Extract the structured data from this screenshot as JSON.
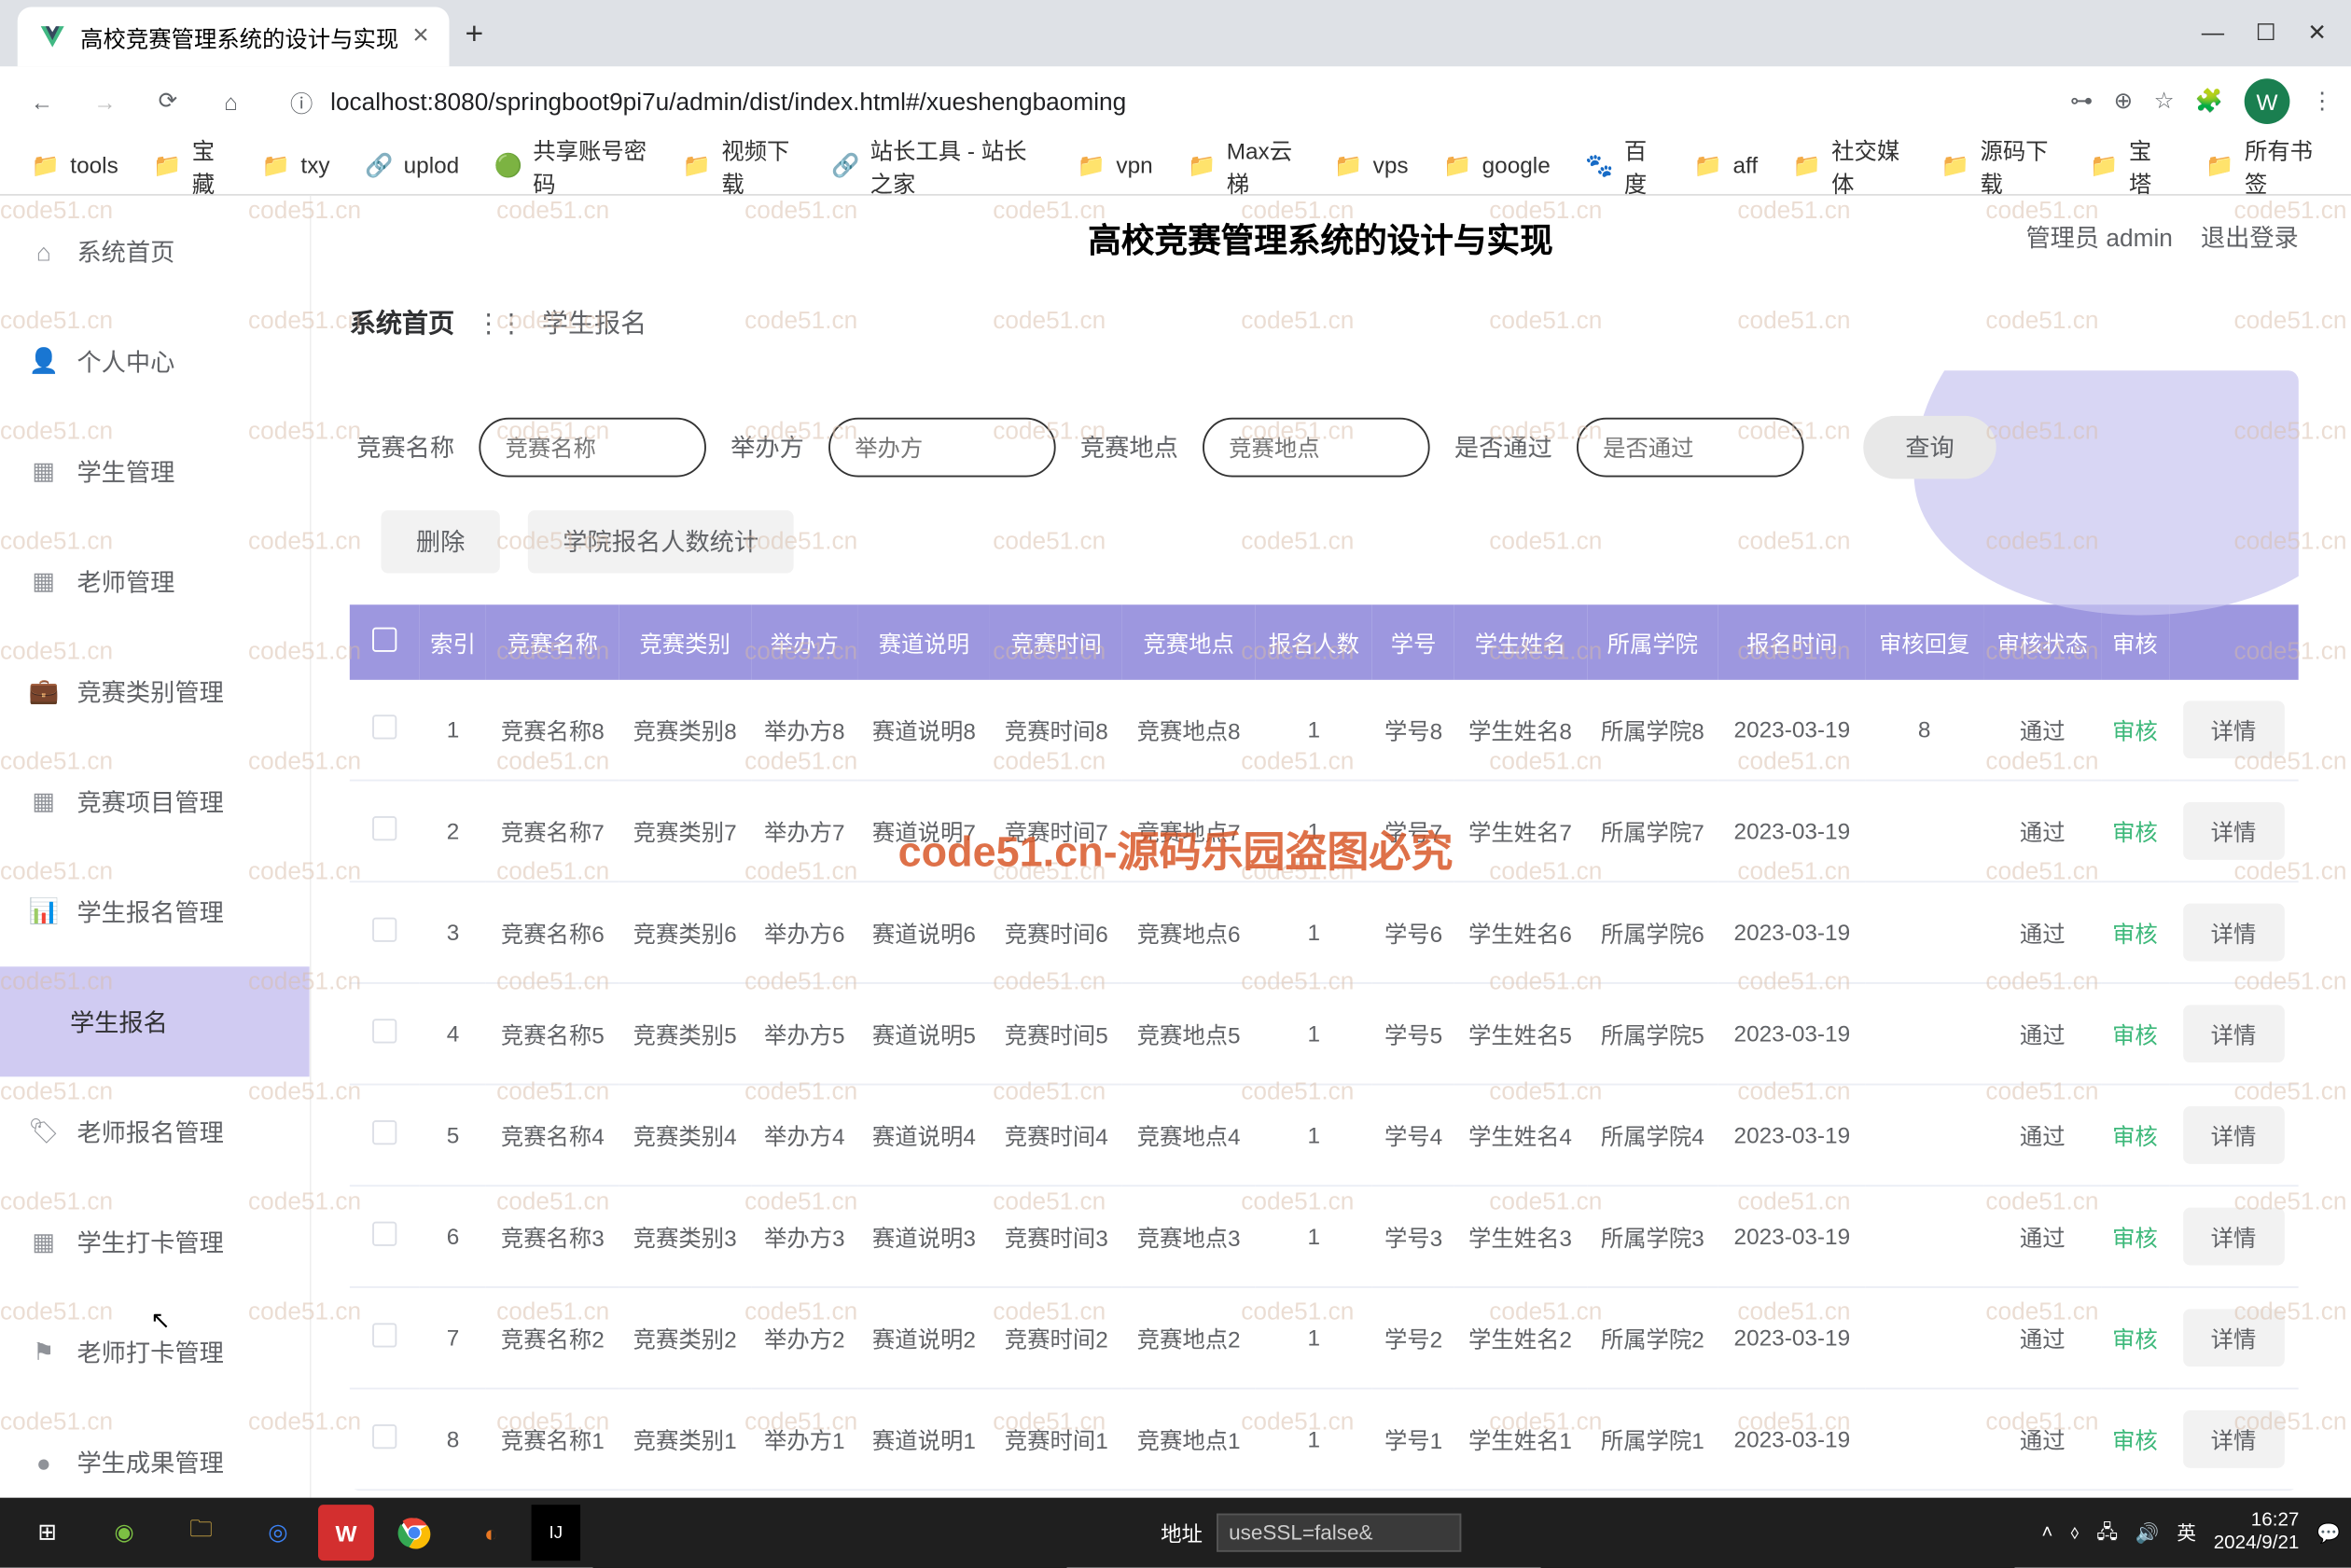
{
  "browser": {
    "tab_title": "高校竞赛管理系统的设计与实现",
    "url": "localhost:8080/springboot9pi7u/admin/dist/index.html#/xueshengbaoming",
    "url_icon_label": "ⓘ",
    "avatar_letter": "W",
    "window_controls": {
      "min": "—",
      "max": "☐",
      "close": "✕"
    }
  },
  "bookmarks": [
    {
      "icon": "📁",
      "label": "tools"
    },
    {
      "icon": "📁",
      "label": "宝藏"
    },
    {
      "icon": "📁",
      "label": "txy"
    },
    {
      "icon": "🔗",
      "label": "uplod"
    },
    {
      "icon": "🟢",
      "label": "共享账号密码"
    },
    {
      "icon": "📁",
      "label": "视频下载"
    },
    {
      "icon": "🔗",
      "label": "站长工具 - 站长之家"
    },
    {
      "icon": "📁",
      "label": "vpn"
    },
    {
      "icon": "📁",
      "label": "Max云梯"
    },
    {
      "icon": "📁",
      "label": "vps"
    },
    {
      "icon": "📁",
      "label": "google"
    },
    {
      "icon": "🐾",
      "label": "百度"
    },
    {
      "icon": "📁",
      "label": "aff"
    },
    {
      "icon": "📁",
      "label": "社交媒体"
    },
    {
      "icon": "📁",
      "label": "源码下载"
    },
    {
      "icon": "📁",
      "label": "宝塔"
    }
  ],
  "bookmark_right": {
    "icon": "📁",
    "label": "所有书签"
  },
  "header": {
    "title": "高校竞赛管理系统的设计与实现",
    "user": "管理员 admin",
    "logout": "退出登录"
  },
  "sidebar": [
    {
      "icon": "⌂",
      "label": "系统首页"
    },
    {
      "icon": "👤",
      "label": "个人中心"
    },
    {
      "icon": "▦",
      "label": "学生管理"
    },
    {
      "icon": "▦",
      "label": "老师管理"
    },
    {
      "icon": "💼",
      "label": "竞赛类别管理"
    },
    {
      "icon": "▦",
      "label": "竞赛项目管理"
    },
    {
      "icon": "📊",
      "label": "学生报名管理"
    },
    {
      "icon": "",
      "label": "学生报名",
      "active": true,
      "sub": true
    },
    {
      "icon": "🏷",
      "label": "老师报名管理"
    },
    {
      "icon": "▦",
      "label": "学生打卡管理"
    },
    {
      "icon": "⚑",
      "label": "老师打卡管理"
    },
    {
      "icon": "●",
      "label": "学生成果管理"
    }
  ],
  "breadcrumb": {
    "home": "系统首页",
    "sep": "⋮⋮",
    "current": "学生报名"
  },
  "filters": [
    {
      "label": "竞赛名称",
      "placeholder": "竞赛名称"
    },
    {
      "label": "举办方",
      "placeholder": "举办方"
    },
    {
      "label": "竞赛地点",
      "placeholder": "竞赛地点"
    },
    {
      "label": "是否通过",
      "placeholder": "是否通过"
    }
  ],
  "query_btn": "查询",
  "actions": {
    "delete": "删除",
    "stats": "学院报名人数统计"
  },
  "table": {
    "headers": [
      "",
      "索引",
      "竞赛名称",
      "竞赛类别",
      "举办方",
      "赛道说明",
      "竞赛时间",
      "竞赛地点",
      "报名人数",
      "学号",
      "学生姓名",
      "所属学院",
      "报名时间",
      "审核回复",
      "审核状态",
      "审核",
      ""
    ],
    "rows": [
      {
        "idx": "1",
        "name": "竞赛名称8",
        "cat": "竞赛类别8",
        "host": "举办方8",
        "desc": "赛道说明8",
        "time": "竞赛时间8",
        "place": "竞赛地点8",
        "count": "1",
        "sid": "学号8",
        "sname": "学生姓名8",
        "college": "所属学院8",
        "regtime": "2023-03-19",
        "reply": "8",
        "status": "通过"
      },
      {
        "idx": "2",
        "name": "竞赛名称7",
        "cat": "竞赛类别7",
        "host": "举办方7",
        "desc": "赛道说明7",
        "time": "竞赛时间7",
        "place": "竞赛地点7",
        "count": "1",
        "sid": "学号7",
        "sname": "学生姓名7",
        "college": "所属学院7",
        "regtime": "2023-03-19",
        "reply": "",
        "status": "通过"
      },
      {
        "idx": "3",
        "name": "竞赛名称6",
        "cat": "竞赛类别6",
        "host": "举办方6",
        "desc": "赛道说明6",
        "time": "竞赛时间6",
        "place": "竞赛地点6",
        "count": "1",
        "sid": "学号6",
        "sname": "学生姓名6",
        "college": "所属学院6",
        "regtime": "2023-03-19",
        "reply": "",
        "status": "通过"
      },
      {
        "idx": "4",
        "name": "竞赛名称5",
        "cat": "竞赛类别5",
        "host": "举办方5",
        "desc": "赛道说明5",
        "time": "竞赛时间5",
        "place": "竞赛地点5",
        "count": "1",
        "sid": "学号5",
        "sname": "学生姓名5",
        "college": "所属学院5",
        "regtime": "2023-03-19",
        "reply": "",
        "status": "通过"
      },
      {
        "idx": "5",
        "name": "竞赛名称4",
        "cat": "竞赛类别4",
        "host": "举办方4",
        "desc": "赛道说明4",
        "time": "竞赛时间4",
        "place": "竞赛地点4",
        "count": "1",
        "sid": "学号4",
        "sname": "学生姓名4",
        "college": "所属学院4",
        "regtime": "2023-03-19",
        "reply": "",
        "status": "通过"
      },
      {
        "idx": "6",
        "name": "竞赛名称3",
        "cat": "竞赛类别3",
        "host": "举办方3",
        "desc": "赛道说明3",
        "time": "竞赛时间3",
        "place": "竞赛地点3",
        "count": "1",
        "sid": "学号3",
        "sname": "学生姓名3",
        "college": "所属学院3",
        "regtime": "2023-03-19",
        "reply": "",
        "status": "通过"
      },
      {
        "idx": "7",
        "name": "竞赛名称2",
        "cat": "竞赛类别2",
        "host": "举办方2",
        "desc": "赛道说明2",
        "time": "竞赛时间2",
        "place": "竞赛地点2",
        "count": "1",
        "sid": "学号2",
        "sname": "学生姓名2",
        "college": "所属学院2",
        "regtime": "2023-03-19",
        "reply": "",
        "status": "通过"
      },
      {
        "idx": "8",
        "name": "竞赛名称1",
        "cat": "竞赛类别1",
        "host": "举办方1",
        "desc": "赛道说明1",
        "time": "竞赛时间1",
        "place": "竞赛地点1",
        "count": "1",
        "sid": "学号1",
        "sname": "学生姓名1",
        "college": "所属学院1",
        "regtime": "2023-03-19",
        "reply": "",
        "status": "通过"
      }
    ],
    "audit_link": "审核",
    "detail_btn": "详情"
  },
  "watermark": {
    "text": "code51.cn",
    "center": "code51.cn-源码乐园盗图必究"
  },
  "taskbar": {
    "center_label": "地址",
    "center_value": "useSSL=false&",
    "ime": "英",
    "time": "16:27",
    "date": "2024/9/21"
  }
}
